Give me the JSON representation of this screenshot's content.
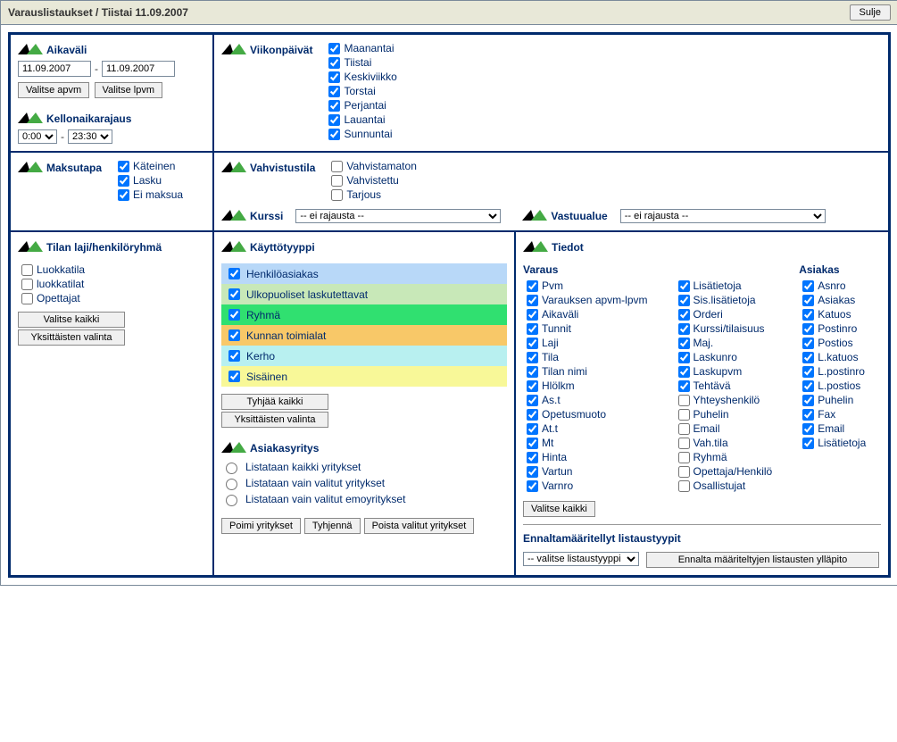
{
  "title": "Varauslistaukset / Tiistai 11.09.2007",
  "close": "Sulje",
  "aikavali": {
    "title": "Aikaväli",
    "from": "11.09.2007",
    "to": "11.09.2007",
    "btn_apvm": "Valitse apvm",
    "btn_lpvm": "Valitse lpvm"
  },
  "kello": {
    "title": "Kellonaikarajaus",
    "from": "0:00",
    "to": "23:30"
  },
  "viikonpaivat": {
    "title": "Viikonpäivät",
    "items": [
      "Maanantai",
      "Tiistai",
      "Keskiviikko",
      "Torstai",
      "Perjantai",
      "Lauantai",
      "Sunnuntai"
    ]
  },
  "maksutapa": {
    "title": "Maksutapa",
    "items": [
      "Käteinen",
      "Lasku",
      "Ei maksua"
    ]
  },
  "vahvistustila": {
    "title": "Vahvistustila",
    "items": [
      "Vahvistamaton",
      "Vahvistettu",
      "Tarjous"
    ]
  },
  "kurssi": {
    "title": "Kurssi",
    "value": "-- ei rajausta --"
  },
  "vastuualue": {
    "title": "Vastuualue",
    "value": "-- ei rajausta --"
  },
  "tilanlaji": {
    "title": "Tilan laji/henkilöryhmä",
    "items": [
      "Luokkatila",
      "luokkatilat",
      "Opettajat"
    ],
    "btn_kaikki": "Valitse kaikki",
    "btn_yks": "Yksittäisten valinta"
  },
  "kayttotyyppi": {
    "title": "Käyttötyyppi",
    "items": [
      "Henkilöasiakas",
      "Ulkopuoliset laskutettavat",
      "Ryhmä",
      "Kunnan toimialat",
      "Kerho",
      "Sisäinen"
    ],
    "btn_tyhj": "Tyhjää kaikki",
    "btn_yks": "Yksittäisten valinta"
  },
  "asiakasyritys": {
    "title": "Asiakasyritys",
    "opts": [
      "Listataan kaikki yritykset",
      "Listataan vain valitut yritykset",
      "Listataan vain valitut emoyritykset"
    ],
    "btn_poimi": "Poimi yritykset",
    "btn_tyhj": "Tyhjennä",
    "btn_poista": "Poista valitut yritykset"
  },
  "tiedot": {
    "title": "Tiedot",
    "varaus": {
      "title": "Varaus",
      "items": [
        {
          "l": "Pvm",
          "c": true
        },
        {
          "l": "Varauksen apvm-lpvm",
          "c": true
        },
        {
          "l": "Aikaväli",
          "c": true
        },
        {
          "l": "Tunnit",
          "c": true
        },
        {
          "l": "Laji",
          "c": true
        },
        {
          "l": "Tila",
          "c": true
        },
        {
          "l": "Tilan nimi",
          "c": true
        },
        {
          "l": "Hlölkm",
          "c": true
        },
        {
          "l": "As.t",
          "c": true
        },
        {
          "l": "Opetusmuoto",
          "c": true
        },
        {
          "l": "At.t",
          "c": true
        },
        {
          "l": "Mt",
          "c": true
        },
        {
          "l": "Hinta",
          "c": true
        },
        {
          "l": "Vartun",
          "c": true
        },
        {
          "l": "Varnro",
          "c": true
        }
      ]
    },
    "col2": [
      {
        "l": "Lisätietoja",
        "c": true
      },
      {
        "l": "Sis.lisätietoja",
        "c": true
      },
      {
        "l": "Orderi",
        "c": true
      },
      {
        "l": "Kurssi/tilaisuus",
        "c": true
      },
      {
        "l": "Maj.",
        "c": true
      },
      {
        "l": "Laskunro",
        "c": true
      },
      {
        "l": "Laskupvm",
        "c": true
      },
      {
        "l": "Tehtävä",
        "c": true
      },
      {
        "l": "Yhteyshenkilö",
        "c": false
      },
      {
        "l": "Puhelin",
        "c": false
      },
      {
        "l": "Email",
        "c": false
      },
      {
        "l": "Vah.tila",
        "c": false
      },
      {
        "l": "Ryhmä",
        "c": false
      },
      {
        "l": "Opettaja/Henkilö",
        "c": false
      },
      {
        "l": "Osallistujat",
        "c": false
      }
    ],
    "asiakas": {
      "title": "Asiakas",
      "items": [
        {
          "l": "Asnro",
          "c": true
        },
        {
          "l": "Asiakas",
          "c": true
        },
        {
          "l": "Katuos",
          "c": true
        },
        {
          "l": "Postinro",
          "c": true
        },
        {
          "l": "Postios",
          "c": true
        },
        {
          "l": "L.katuos",
          "c": true
        },
        {
          "l": "L.postinro",
          "c": true
        },
        {
          "l": "L.postios",
          "c": true
        },
        {
          "l": "Puhelin",
          "c": true
        },
        {
          "l": "Fax",
          "c": true
        },
        {
          "l": "Email",
          "c": true
        },
        {
          "l": "Lisätietoja",
          "c": true
        }
      ]
    },
    "btn_kaikki": "Valitse kaikki",
    "predef_title": "Ennaltamääritellyt listaustyypit",
    "predef_sel": "-- valitse listaustyyppi --",
    "predef_btn": "Ennalta määriteltyjen listausten ylläpito"
  }
}
